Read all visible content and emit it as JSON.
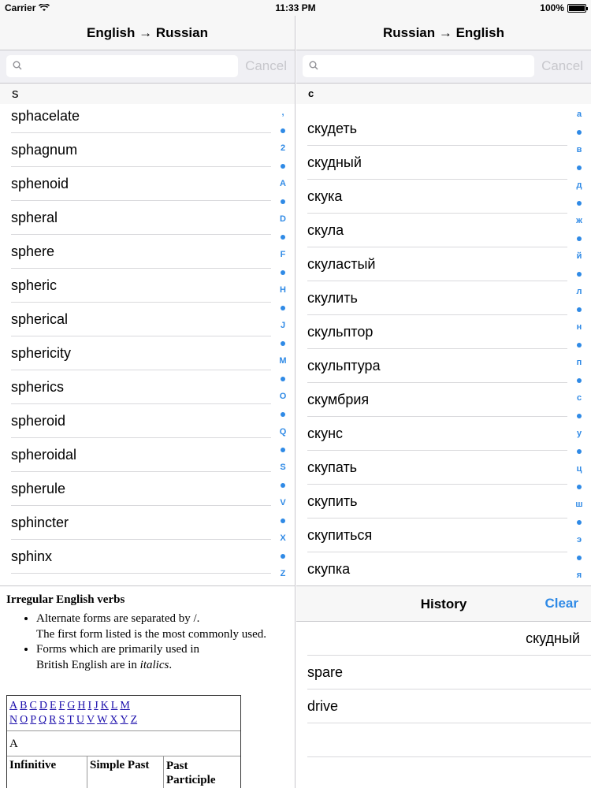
{
  "status_bar": {
    "carrier": "Carrier",
    "time": "11:33 PM",
    "battery": "100%"
  },
  "left_pane": {
    "title": "English → Russian",
    "search": {
      "placeholder": "",
      "value": "",
      "cancel": "Cancel"
    },
    "section_header": "s",
    "words": [
      "sphacelate",
      "sphagnum",
      "sphenoid",
      "spheral",
      "sphere",
      "spheric",
      "spherical",
      "sphericity",
      "spherics",
      "spheroid",
      "spheroidal",
      "spherule",
      "sphincter",
      "sphinx"
    ],
    "index": [
      ",",
      "•",
      "2",
      "•",
      "A",
      "•",
      "D",
      "•",
      "F",
      "•",
      "H",
      "•",
      "J",
      "•",
      "M",
      "•",
      "O",
      "•",
      "Q",
      "•",
      "S",
      "•",
      "V",
      "•",
      "X",
      "•",
      "Z"
    ]
  },
  "right_pane": {
    "title": "Russian → English",
    "search": {
      "placeholder": "",
      "value": "",
      "cancel": "Cancel"
    },
    "section_header": "с",
    "words": [
      "скудеть",
      "скудный",
      "скука",
      "скула",
      "скуластый",
      "скулить",
      "скульптор",
      "скульптура",
      "скумбрия",
      "скунс",
      "скупать",
      "скупить",
      "скупиться",
      "скупка"
    ],
    "index": [
      "а",
      "•",
      "в",
      "•",
      "д",
      "•",
      "ж",
      "•",
      "й",
      "•",
      "л",
      "•",
      "н",
      "•",
      "п",
      "•",
      "с",
      "•",
      "у",
      "•",
      "ц",
      "•",
      "ш",
      "•",
      "э",
      "•",
      "я"
    ]
  },
  "irregular_verbs": {
    "title": "Irregular English verbs",
    "note1_line1": "Alternate forms are separated by /.",
    "note1_line2": "The first form listed is the most commonly used.",
    "note2_line1": "Forms which are primarily used in",
    "note2_line2_prefix": "British English are in ",
    "note2_line2_italic": "italics",
    "note2_line2_suffix": ".",
    "letters_row1": [
      "A",
      "B",
      "C",
      "D",
      "E",
      "F",
      "G",
      "H",
      "I",
      "J",
      "K",
      "L",
      "M"
    ],
    "letters_row2": [
      "N",
      "O",
      "P",
      "Q",
      "R",
      "S",
      "T",
      "U",
      "V",
      "W",
      "X",
      "Y",
      "Z"
    ],
    "section_letter": "A",
    "columns": [
      "Infinitive",
      "Simple Past",
      "Past Participle"
    ]
  },
  "history": {
    "title": "History",
    "clear": "Clear",
    "items": [
      {
        "text": "скудный",
        "align": "right"
      },
      {
        "text": "spare",
        "align": "left"
      },
      {
        "text": "drive",
        "align": "left"
      },
      {
        "text": "",
        "align": "left"
      }
    ]
  },
  "colors": {
    "accent": "#2f8ae6",
    "separator": "#c8c7cc",
    "bar_bg": "#f7f7f7"
  }
}
